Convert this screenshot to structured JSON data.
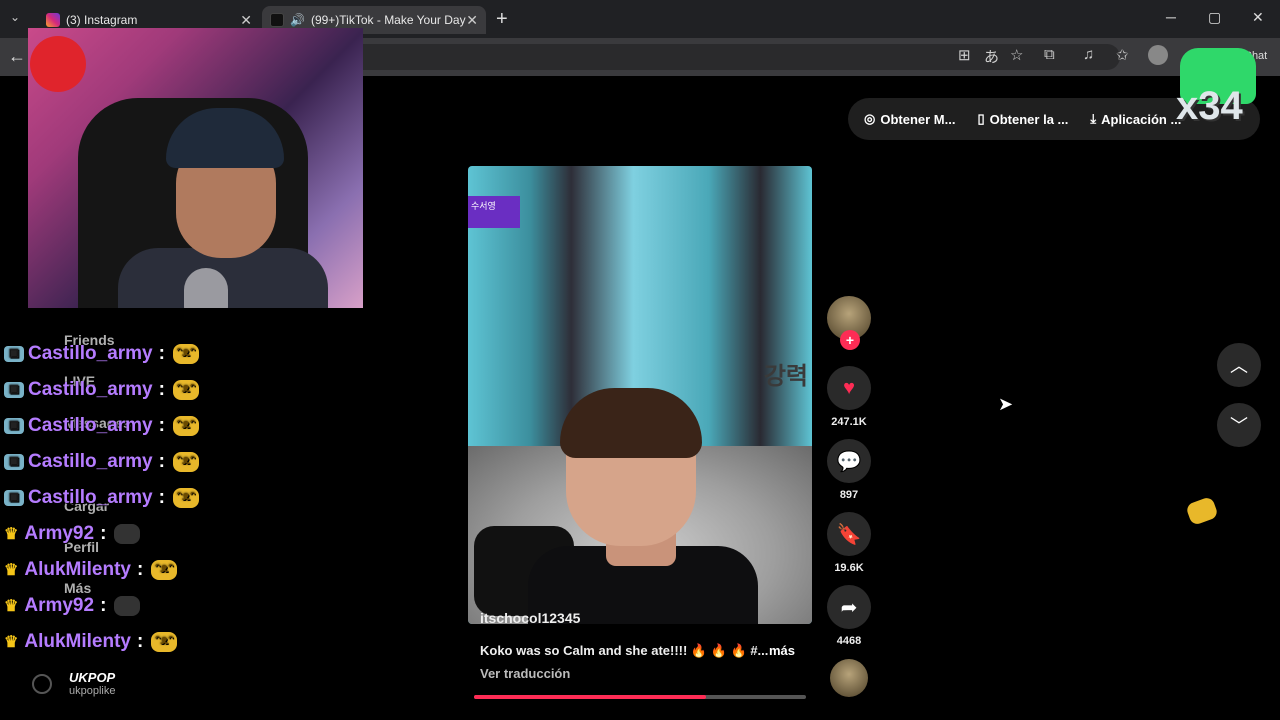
{
  "browser": {
    "tabs": [
      {
        "label": "(3) Instagram",
        "active": false
      },
      {
        "label": "(99+)TikTok - Make Your Day",
        "active": true
      }
    ],
    "new_tab": "+",
    "window_controls": [
      "─",
      "▢",
      "✕"
    ],
    "profile_label": "Chat"
  },
  "tiktok": {
    "top_buttons": [
      "Obtener M...",
      "Obtener la ...",
      "Aplicación ..."
    ],
    "video": {
      "author": "itschocol12345",
      "description": "Koko was so Calm and she ate!!!! 🔥 🔥 🔥 #...",
      "more_label": "más",
      "translate_label": "Ver traducción",
      "korean_tag": "수서영",
      "korean_side": "강력",
      "progress": 0.7
    },
    "actions": {
      "likes": "247.1K",
      "comments": "897",
      "saves": "19.6K",
      "shares": "4468"
    },
    "sidebar": [
      "Friends",
      "LIVE",
      "Messages",
      "Cargar",
      "Perfil",
      "Más"
    ],
    "account": {
      "name": "UKPOP",
      "handle": "ukpoplike"
    }
  },
  "chat": [
    {
      "user": "Castillo_army",
      "sep": ":",
      "type": "badge"
    },
    {
      "user": "Castillo_army",
      "sep": ":",
      "type": "badge"
    },
    {
      "user": "Castillo_army",
      "sep": ":",
      "type": "badge"
    },
    {
      "user": "Castillo_army",
      "sep": ":",
      "type": "badge"
    },
    {
      "user": "Castillo_army",
      "sep": ":",
      "type": "badge"
    },
    {
      "user": "Army92",
      "sep": ":",
      "type": "crown"
    },
    {
      "user": "AlukMilenty",
      "sep": ":",
      "type": "crown"
    },
    {
      "user": "Army92",
      "sep": ":",
      "type": "crown"
    },
    {
      "user": "AlukMilenty",
      "sep": ":",
      "type": "crown"
    }
  ],
  "overlay": {
    "multiplier": "x34"
  },
  "colors": {
    "accent": "#fe2c55",
    "chat_purple": "#b57cff",
    "chat_white": "#ffffff"
  }
}
